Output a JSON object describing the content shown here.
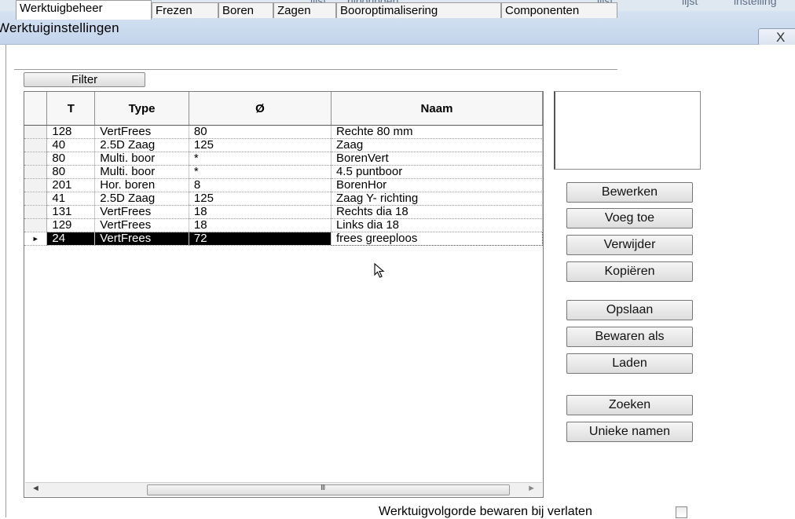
{
  "top_strip": [
    "lijst",
    "rijboringen",
    "lijst",
    "lijst",
    "instelling"
  ],
  "window": {
    "title": "Werktuiginstellingen",
    "close_glyph": "X"
  },
  "tabs": [
    {
      "label": "Werktuigbeheer",
      "active": true
    },
    {
      "label": "Frezen",
      "active": false
    },
    {
      "label": "Boren",
      "active": false
    },
    {
      "label": "Zagen",
      "active": false
    },
    {
      "label": "Booroptimalisering",
      "active": false
    },
    {
      "label": "Componenten",
      "active": false
    }
  ],
  "filter_label": "Filter",
  "grid": {
    "columns": [
      "T",
      "Type",
      "Ø",
      "Naam"
    ],
    "rows": [
      {
        "t": "128",
        "type": "VertFrees",
        "diameter": "80",
        "naam": "Rechte 80 mm"
      },
      {
        "t": "40",
        "type": "2.5D Zaag",
        "diameter": "125",
        "naam": "Zaag"
      },
      {
        "t": "80",
        "type": "Multi. boor",
        "diameter": "*",
        "naam": "BorenVert"
      },
      {
        "t": "80",
        "type": "Multi. boor",
        "diameter": "*",
        "naam": "4.5 puntboor"
      },
      {
        "t": "201",
        "type": "Hor. boren",
        "diameter": "8",
        "naam": "BorenHor"
      },
      {
        "t": "41",
        "type": "2.5D Zaag",
        "diameter": "125",
        "naam": "Zaag Y- richting"
      },
      {
        "t": "131",
        "type": "VertFrees",
        "diameter": "18",
        "naam": "Rechts dia 18"
      },
      {
        "t": "129",
        "type": "VertFrees",
        "diameter": "18",
        "naam": "Links dia 18"
      },
      {
        "t": "24",
        "type": "VertFrees",
        "diameter": "72",
        "naam": "frees greeploos"
      }
    ],
    "selected_row": 8,
    "row_marker": "►"
  },
  "buttons": {
    "bewerken": "Bewerken",
    "voeg_toe": "Voeg toe",
    "verwijder": "Verwijder",
    "kopieren": "Kopiëren",
    "opslaan": "Opslaan",
    "bewaren_als": "Bewaren als",
    "laden": "Laden",
    "zoeken": "Zoeken",
    "unieke_namen": "Unieke namen"
  },
  "scrollbar": {
    "left_arrow": "◄",
    "right_arrow": "►",
    "grip": "III"
  },
  "footer": {
    "checkbox_label": "Werktuigvolgorde bewaren bij verlaten",
    "checked": false
  },
  "icons": [
    "close-icon",
    "row-pointer-icon",
    "mouse-cursor-icon",
    "scroll-left-icon",
    "scroll-right-icon"
  ]
}
